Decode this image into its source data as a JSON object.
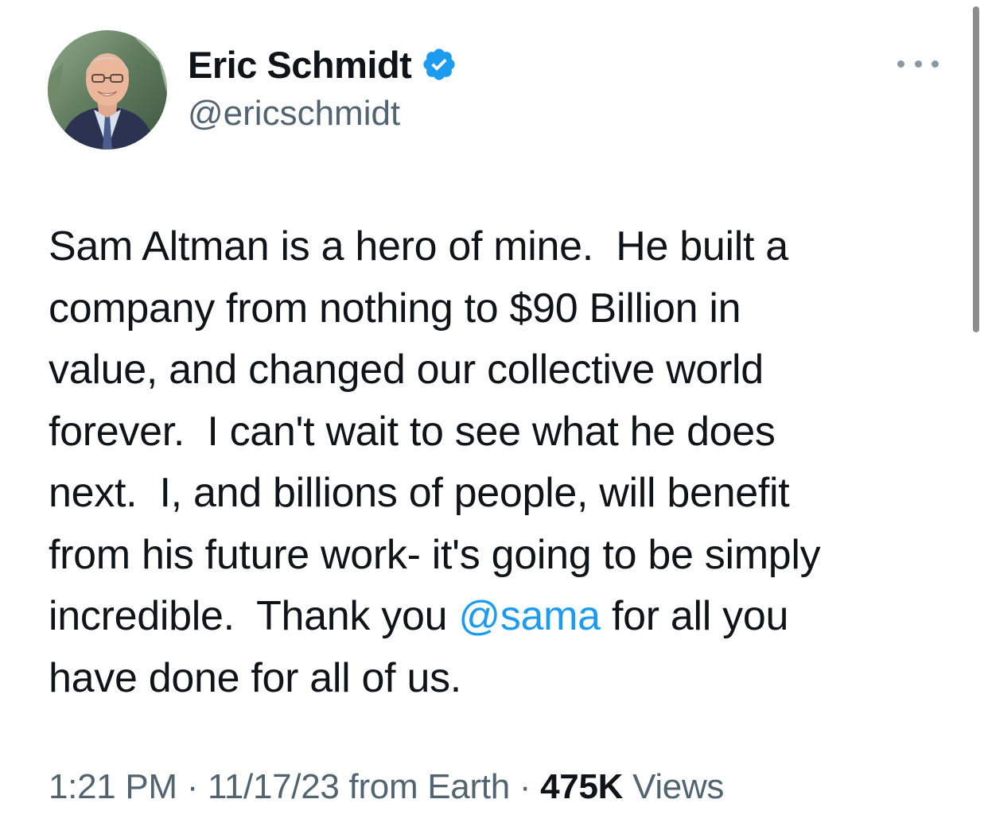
{
  "author": {
    "display_name": "Eric Schmidt",
    "handle": "@ericschmidt",
    "verified": true
  },
  "tweet": {
    "lines": [
      {
        "before": "Sam Altman is a hero of mine.  He built a"
      },
      {
        "before": "company from nothing to $90 Billion in"
      },
      {
        "before": "value, and changed our collective world"
      },
      {
        "before": "forever.  I can't wait to see what he does"
      },
      {
        "before": "next.  I, and billions of people, will benefit"
      },
      {
        "before": "from his future work- it's going to be simply"
      },
      {
        "before": "incredible.  Thank you ",
        "mention": "@sama",
        "after": " for all you"
      },
      {
        "before": "have done for all of us."
      }
    ]
  },
  "meta": {
    "time": "1:21 PM",
    "date": "11/17/23",
    "source": "from Earth",
    "views_count": "475K",
    "views_label": "Views"
  },
  "icons": {
    "verified": "verified-badge-icon",
    "more": "more-options-icon"
  },
  "colors": {
    "accent": "#1d9bf0",
    "text": "#0f1419",
    "secondary": "#536471"
  }
}
